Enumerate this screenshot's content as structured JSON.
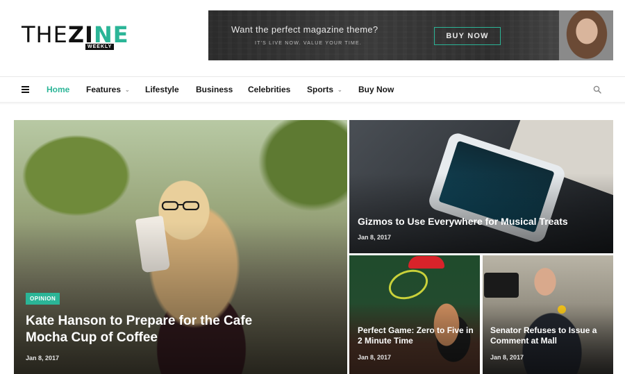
{
  "logo": {
    "the": "THE",
    "zi": "ZI",
    "ne": "NE",
    "badge": "WEEKLY"
  },
  "banner": {
    "headline": "Want the perfect magazine theme?",
    "subline": "IT'S LIVE NOW. VALUE YOUR TIME.",
    "cta_label": "BUY NOW"
  },
  "nav": {
    "menu_icon": "hamburger-icon",
    "items": [
      {
        "label": "Home",
        "active": true,
        "has_dropdown": false
      },
      {
        "label": "Features",
        "active": false,
        "has_dropdown": true
      },
      {
        "label": "Lifestyle",
        "active": false,
        "has_dropdown": false
      },
      {
        "label": "Business",
        "active": false,
        "has_dropdown": false
      },
      {
        "label": "Celebrities",
        "active": false,
        "has_dropdown": false
      },
      {
        "label": "Sports",
        "active": false,
        "has_dropdown": true
      },
      {
        "label": "Buy Now",
        "active": false,
        "has_dropdown": false
      }
    ],
    "search_icon": "search-icon"
  },
  "featured": {
    "main": {
      "badge": "OPINION",
      "title": "Kate Hanson to Prepare for the Cafe Mocha Cup of Coffee",
      "date": "Jan 8, 2017"
    },
    "top_right": {
      "title": "Gizmos to Use Everywhere for Musical Treats",
      "date": "Jan 8, 2017"
    },
    "bottom_left": {
      "title": "Perfect Game: Zero to Five in 2 Minute Time",
      "date": "Jan 8, 2017"
    },
    "bottom_right": {
      "title": "Senator Refuses to Issue a Comment at Mall",
      "date": "Jan 8, 2017"
    }
  },
  "colors": {
    "accent": "#2bb597",
    "text": "#161616",
    "badge_bg": "#2bb597"
  }
}
